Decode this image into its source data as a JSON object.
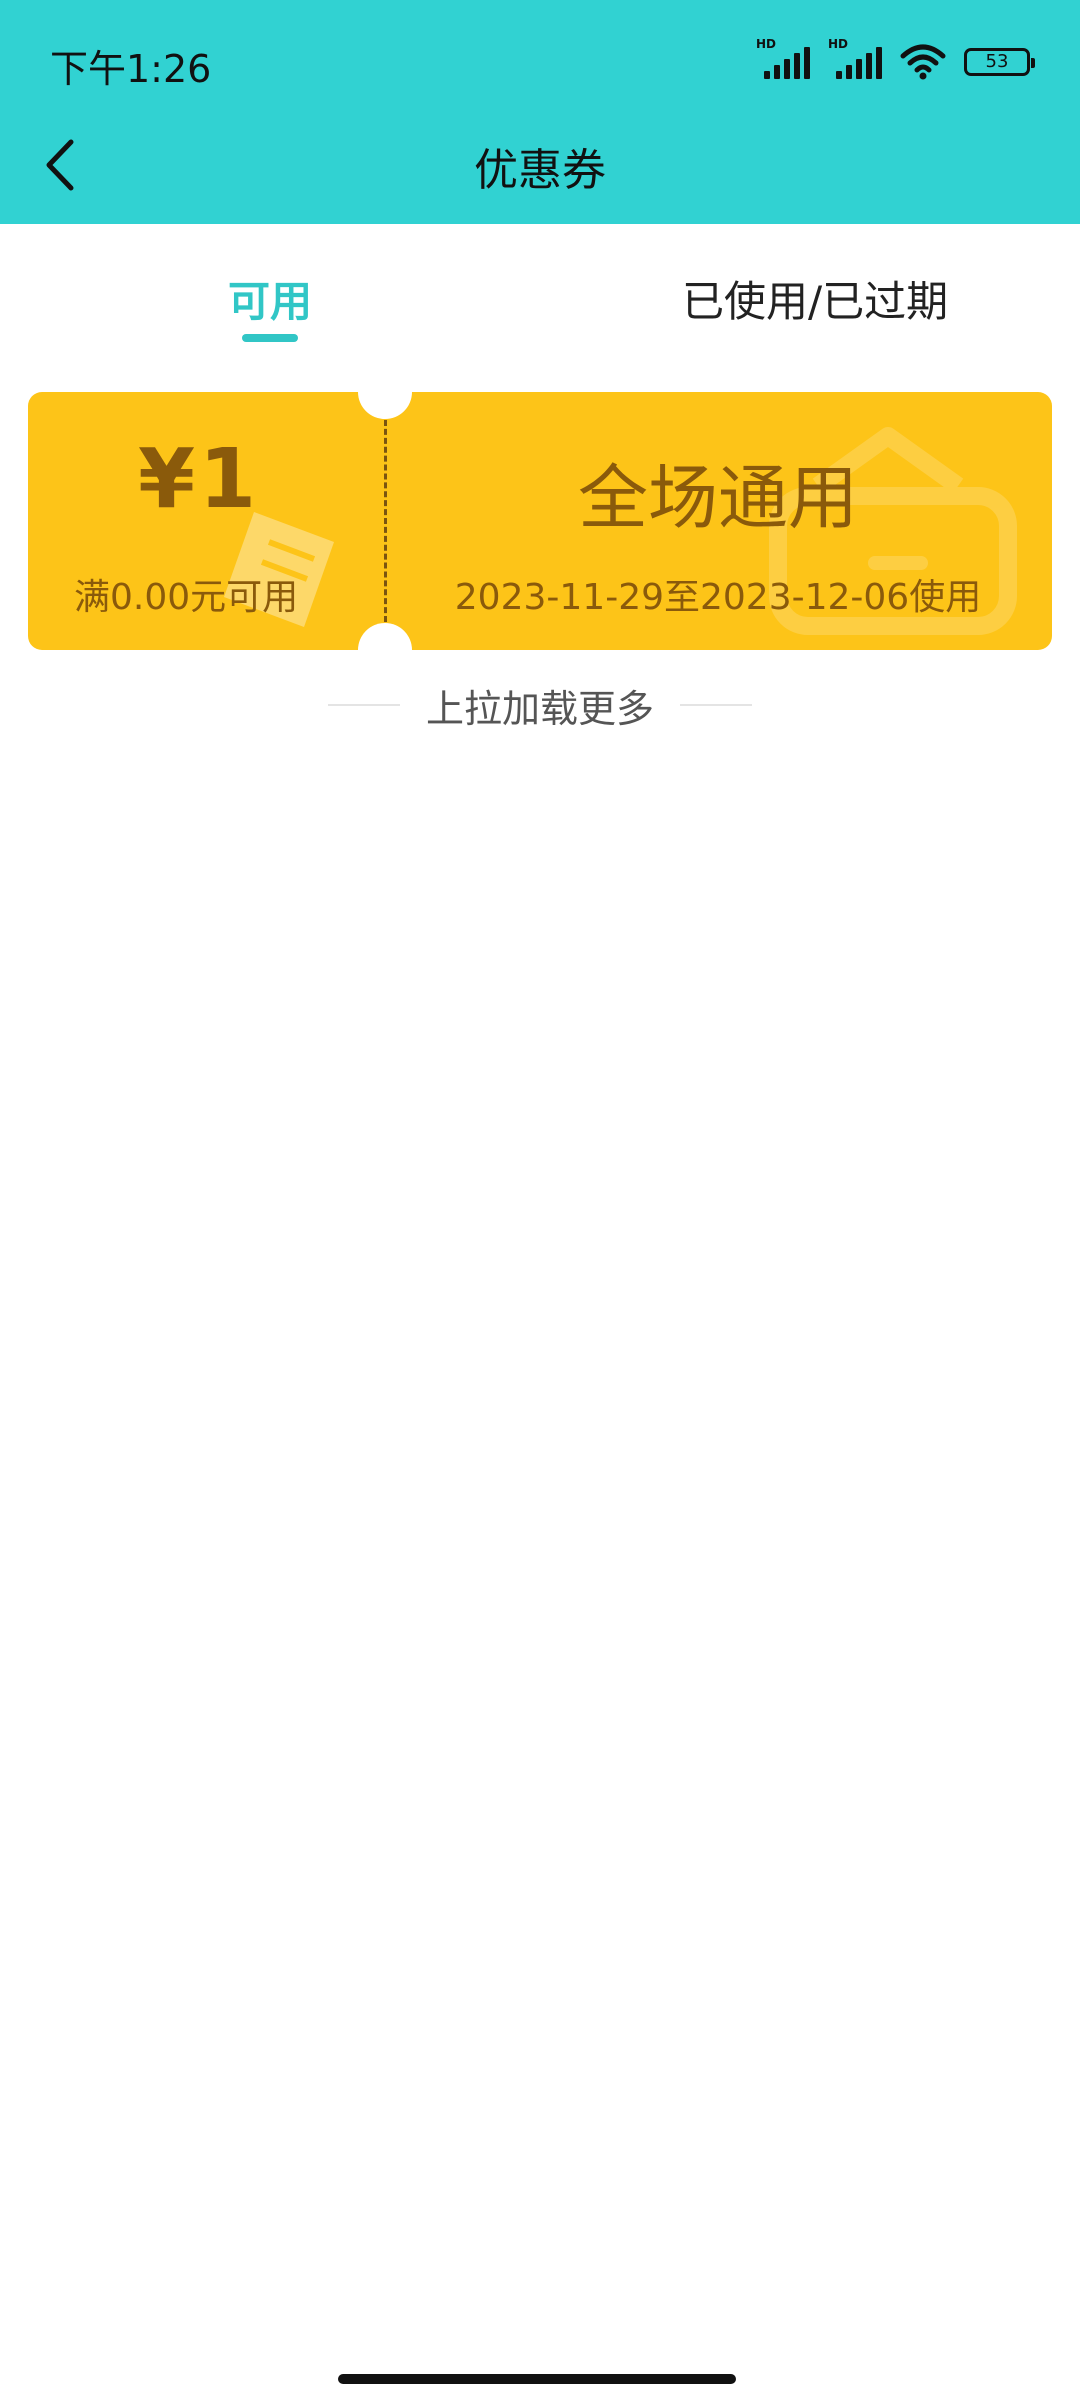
{
  "status_bar": {
    "time": "下午1:26",
    "signal_1_label": "HD",
    "signal_2_label": "HD",
    "battery": "53"
  },
  "header": {
    "title": "优惠券"
  },
  "tabs": [
    {
      "label": "可用",
      "active": true
    },
    {
      "label": "已使用/已过期",
      "active": false
    }
  ],
  "coupon": {
    "amount": "¥1",
    "condition": "满0.00元可用",
    "scope": "全场通用",
    "validity": "2023-11-29至2023-12-06使用"
  },
  "list_footer": {
    "text": "上拉加载更多"
  },
  "colors": {
    "header_bg": "#31D2D2",
    "accent": "#31C6C6",
    "coupon_bg": "#FDC418",
    "coupon_text": "#8A5A0B"
  },
  "icons": {
    "back": "chevron-left-icon",
    "wifi": "wifi-icon",
    "battery": "battery-icon",
    "signal": "signal-icon"
  }
}
